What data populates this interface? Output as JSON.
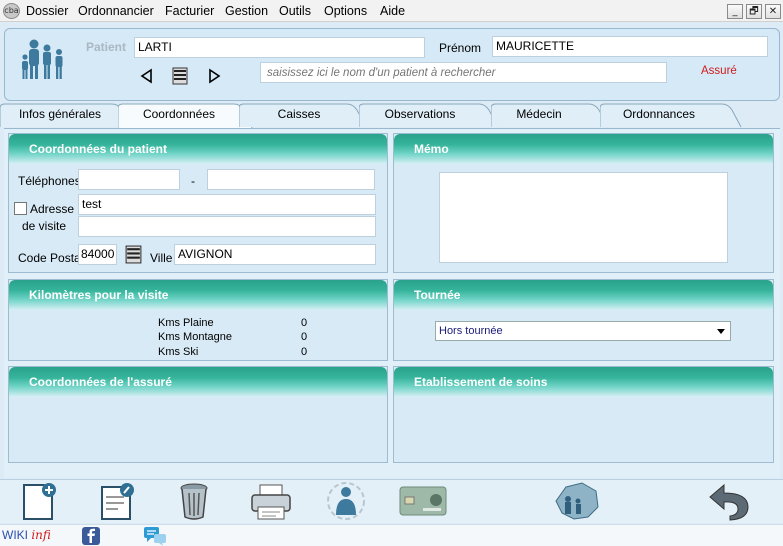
{
  "app": {
    "logo_text": "cba",
    "menu": [
      "Dossier",
      "Ordonnancier",
      "Facturier",
      "Gestion",
      "Outils",
      "Options",
      "Aide"
    ],
    "window_buttons": [
      "_",
      "🗗",
      "✕"
    ]
  },
  "patient": {
    "label_patient": "Patient",
    "nom": "LARTI",
    "label_prenom": "Prénom",
    "prenom": "MAURICETTE",
    "search_placeholder": "saisissez ici le nom d'un patient à rechercher",
    "status": "Assuré"
  },
  "tabs": [
    {
      "label": "Infos générales",
      "active": false
    },
    {
      "label": "Coordonnées",
      "active": true
    },
    {
      "label": "Caisses",
      "active": false
    },
    {
      "label": "Observations",
      "active": false
    },
    {
      "label": "Médecin",
      "active": false
    },
    {
      "label": "Ordonnances",
      "active": false
    }
  ],
  "coordonnees": {
    "title": "Coordonnées du patient",
    "label_telephones": "Téléphones",
    "tel1": "",
    "tel_separator": "-",
    "tel2": "",
    "label_adresse": "Adresse",
    "label_de_visite": "de visite",
    "adresse1": "test",
    "adresse2": "",
    "label_code_postal": "Code Postal",
    "code_postal": "84000",
    "label_ville": "Ville",
    "ville": "AVIGNON"
  },
  "memo": {
    "title": "Mémo",
    "text": ""
  },
  "kilometres": {
    "title": "Kilomètres pour la visite",
    "rows": [
      {
        "label": "Kms Plaine",
        "value": "0"
      },
      {
        "label": "Kms Montagne",
        "value": "0"
      },
      {
        "label": "Kms Ski",
        "value": "0"
      }
    ]
  },
  "tournee": {
    "title": "Tournée",
    "selected": "Hors tournée"
  },
  "assure": {
    "title": "Coordonnées de l'assuré"
  },
  "etablissement": {
    "title": "Etablissement de soins"
  },
  "footer": {
    "wiki_prefix": "WIKI",
    "wiki_suffix": "infi"
  },
  "colors": {
    "panel_header": "#36b49b",
    "status_red": "#d01c1c",
    "background": "#dcebf5"
  }
}
